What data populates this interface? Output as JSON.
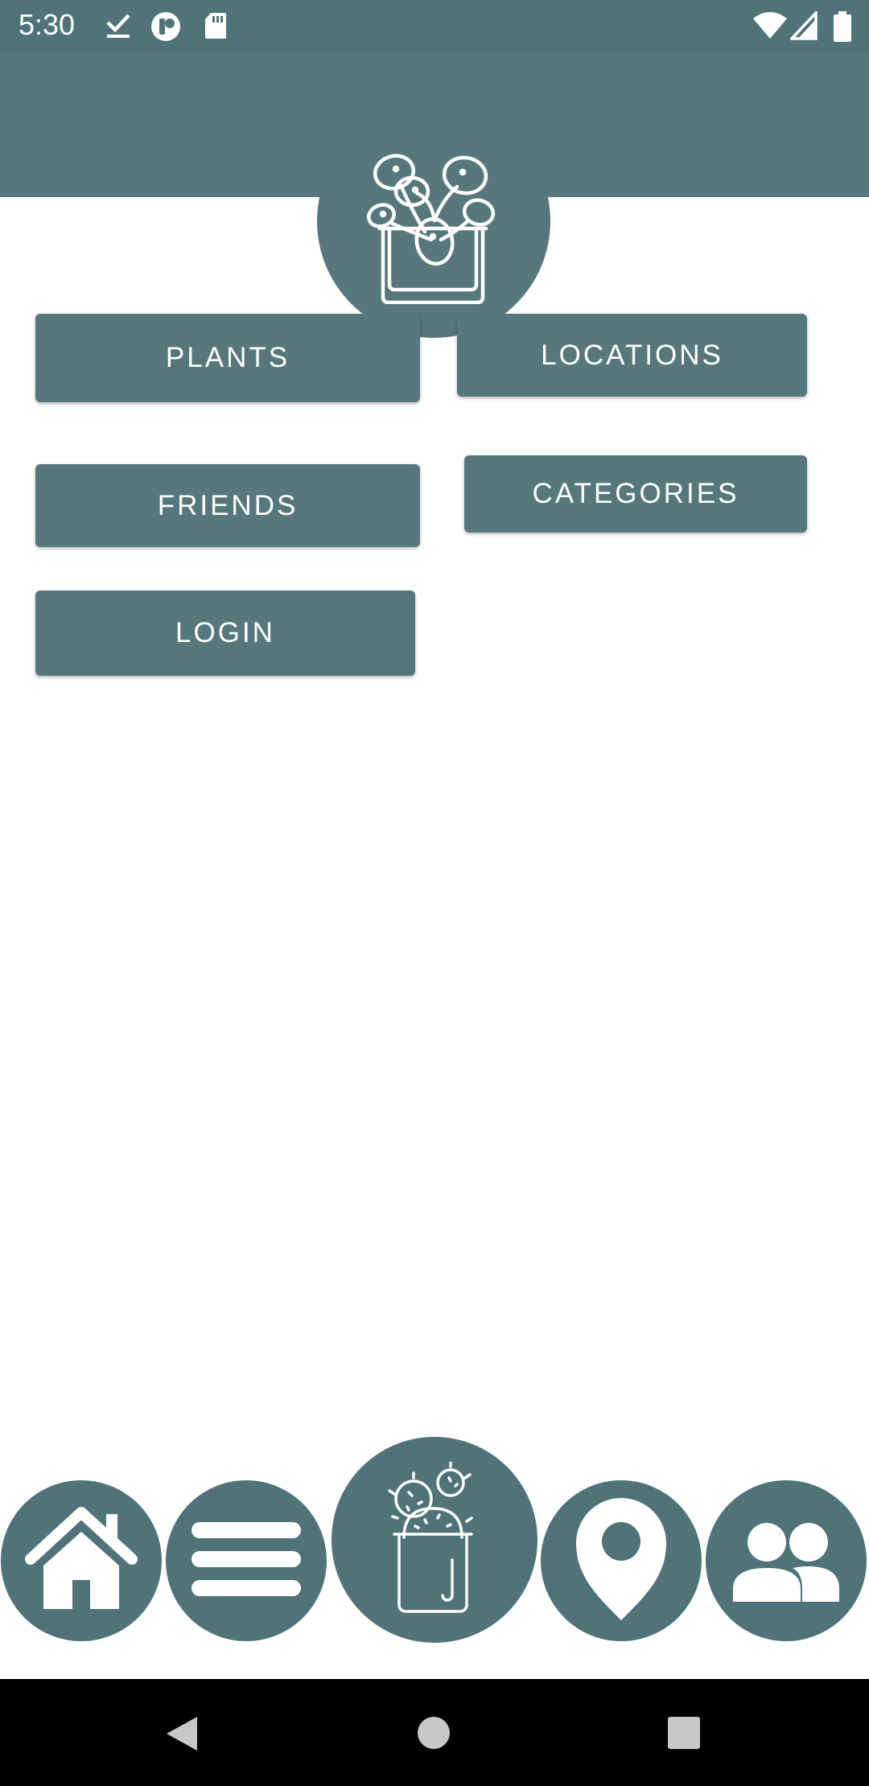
{
  "status_bar": {
    "time": "5:30",
    "left_icons": [
      "download-done-icon",
      "app-badge-icon",
      "sd-card-icon"
    ],
    "right_icons": [
      "wifi-icon",
      "signal-icon",
      "battery-icon"
    ]
  },
  "header": {
    "logo": "potted-plant-icon"
  },
  "menu": {
    "plants": "PLANTS",
    "locations": "LOCATIONS",
    "friends": "FRIENDS",
    "categories": "CATEGORIES",
    "login": "LOGIN"
  },
  "bottom_nav": {
    "items": [
      "home-icon",
      "menu-icon",
      "cactus-icon",
      "location-pin-icon",
      "people-icon"
    ]
  },
  "system_nav": {
    "items": [
      "back-icon",
      "home-circle-icon",
      "recents-icon"
    ]
  },
  "colors": {
    "primary": "#56787d",
    "status_bar": "#4f7379",
    "nav": "#4f7379",
    "text_on_primary": "#ffffff"
  }
}
